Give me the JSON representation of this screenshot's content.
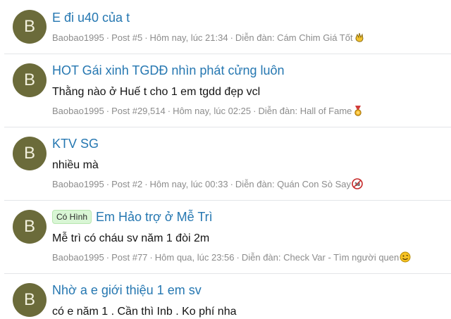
{
  "results": [
    {
      "avatar_letter": "B",
      "title": "E đi u40 của t",
      "badge": "",
      "snippet": "",
      "author": "Baobao1995",
      "post": "Post #5",
      "time": "Hôm nay, lúc 21:34",
      "forum": "Diễn đàn: Cám Chim Giá Tốt",
      "forum_icon": "hand-icon"
    },
    {
      "avatar_letter": "B",
      "title": "HOT Gái xinh TGDĐ nhìn phát cửng luôn",
      "badge": "",
      "snippet": "Thằng nào ở Huế t cho 1 em tgdd đẹp vcl",
      "author": "Baobao1995",
      "post": "Post #29,514",
      "time": "Hôm nay, lúc 02:25",
      "forum": "Diễn đàn: Hall of Fame",
      "forum_icon": "medal-icon"
    },
    {
      "avatar_letter": "B",
      "title": "KTV SG",
      "badge": "",
      "snippet": "nhiều mà",
      "author": "Baobao1995",
      "post": "Post #2",
      "time": "Hôm nay, lúc 00:33",
      "forum": "Diễn đàn: Quán Con Sò Say",
      "forum_icon": "eighteen-plus-icon"
    },
    {
      "avatar_letter": "B",
      "title": "Em Hảo trợ ở Mễ Trì",
      "badge": "Có Hình",
      "snippet": "Mễ trì có cháu sv năm 1 đòi 2m",
      "author": "Baobao1995",
      "post": "Post #77",
      "time": "Hôm qua, lúc 23:56",
      "forum": "Diễn đàn: Check Var - Tìm người quen",
      "forum_icon": "smiley-icon"
    },
    {
      "avatar_letter": "B",
      "title": "Nhờ a e giới thiệu 1 em sv",
      "badge": "",
      "snippet": "có e năm 1 . Cần thì Inb . Ko phí nha",
      "author": "",
      "post": "",
      "time": "",
      "forum": "",
      "forum_icon": ""
    }
  ],
  "meta_separator": "·",
  "colors": {
    "link": "#2577b1",
    "muted": "#8c8c8c",
    "avatar_bg": "#6b6b3a",
    "badge_bg": "#d9f6d5"
  }
}
